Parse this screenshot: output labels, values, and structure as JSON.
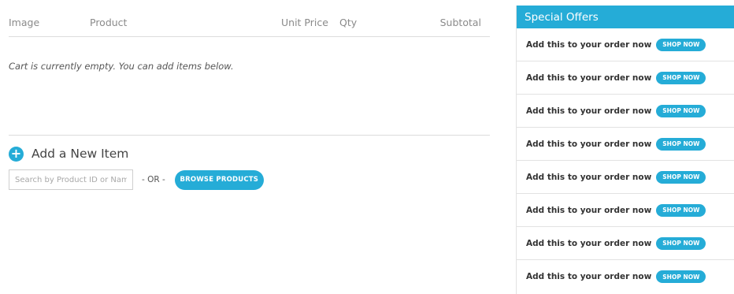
{
  "cart": {
    "columns": {
      "image": "Image",
      "product": "Product",
      "unit_price": "Unit Price",
      "qty": "Qty",
      "subtotal": "Subtotal"
    },
    "empty_message": "Cart is currently empty. You can add items below."
  },
  "add_item": {
    "icon": "plus-icon",
    "plus_glyph": "+",
    "title": "Add a New Item",
    "search_placeholder": "Search by Product ID or Name",
    "or_label": "- OR -",
    "browse_label": "BROWSE PRODUCTS"
  },
  "special_offers": {
    "title": "Special Offers",
    "items": [
      {
        "text": "Add this to your order now",
        "button": "SHOP NOW"
      },
      {
        "text": "Add this to your order now",
        "button": "SHOP NOW"
      },
      {
        "text": "Add this to your order now",
        "button": "SHOP NOW"
      },
      {
        "text": "Add this to your order now",
        "button": "SHOP NOW"
      },
      {
        "text": "Add this to your order now",
        "button": "SHOP NOW"
      },
      {
        "text": "Add this to your order now",
        "button": "SHOP NOW"
      },
      {
        "text": "Add this to your order now",
        "button": "SHOP NOW"
      },
      {
        "text": "Add this to your order now",
        "button": "SHOP NOW"
      }
    ]
  },
  "colors": {
    "accent": "#25acd7",
    "divider": "#dcdcdc"
  }
}
